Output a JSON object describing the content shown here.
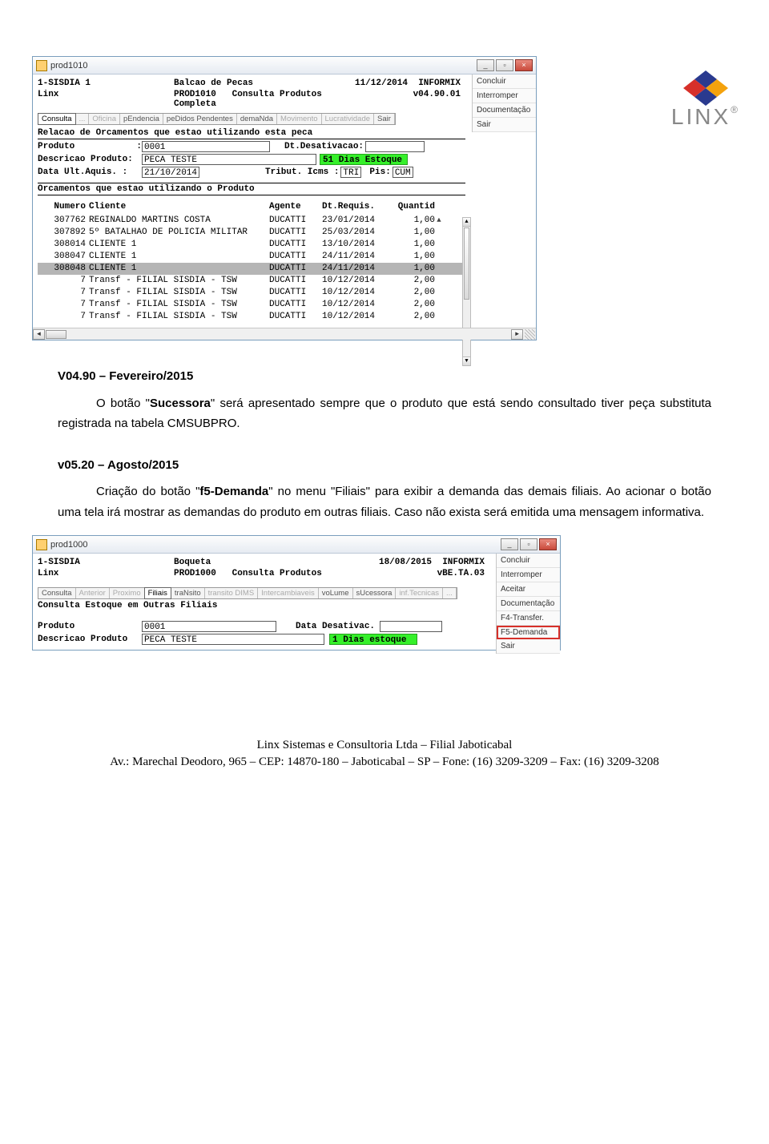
{
  "logo": {
    "text": "LINX",
    "reg": "®"
  },
  "win1": {
    "title": "prod1010",
    "header": {
      "l1a": "1-SISDIA 1",
      "l1b": "Balcao de Pecas",
      "l1c_date": "11/12/2014",
      "l1c_db": "INFORMIX",
      "l2a": "Linx",
      "l2b_prog": "PROD1010",
      "l2b_desc": "Consulta Produtos Completa",
      "l2c": "v04.90.01"
    },
    "tabs": [
      "Consulta",
      "...",
      "Oficina",
      "pEndencia",
      "peDidos Pendentes",
      "demaNda",
      "Movimento",
      "Lucratividade",
      "Sair"
    ],
    "panel_title": "Relacao de Orcamentos que estao utilizando esta peca",
    "fields": {
      "produto_lbl": "Produto",
      "produto_sep": ":",
      "produto_val": "0001",
      "dtdes_lbl": "Dt.Desativacao:",
      "desc_lbl": "Descricao Produto:",
      "desc_val": "PECA TESTE",
      "estoque": "51 Dias Estoque",
      "data_lbl": "Data  Ult.Aquis.  :",
      "data_val": "21/10/2014",
      "trib_lbl": "Tribut. Icms  :",
      "trib_val": "TRI",
      "pis_lbl": "Pis:",
      "pis_val": "CUM"
    },
    "panel_title2": "Orcamentos que estao utilizando o Produto",
    "grid_head": {
      "num": "Numero",
      "cli": "Cliente",
      "ag": "Agente",
      "dt": "Dt.Requis.",
      "qt": "Quantid"
    },
    "rows": [
      {
        "num": "307762",
        "cli": "REGINALDO MARTINS COSTA",
        "ag": "DUCATTI",
        "dt": "23/01/2014",
        "qt": "1,00"
      },
      {
        "num": "307892",
        "cli": "5º BATALHAO DE POLICIA MILITAR",
        "ag": "DUCATTI",
        "dt": "25/03/2014",
        "qt": "1,00"
      },
      {
        "num": "308014",
        "cli": "CLIENTE 1",
        "ag": "DUCATTI",
        "dt": "13/10/2014",
        "qt": "1,00"
      },
      {
        "num": "308047",
        "cli": "CLIENTE 1",
        "ag": "DUCATTI",
        "dt": "24/11/2014",
        "qt": "1,00"
      },
      {
        "num": "308048",
        "cli": "CLIENTE 1",
        "ag": "DUCATTI",
        "dt": "24/11/2014",
        "qt": "1,00",
        "sel": true
      },
      {
        "num": "7",
        "cli": "Transf - FILIAL SISDIA - TSW",
        "ag": "DUCATTI",
        "dt": "10/12/2014",
        "qt": "2,00"
      },
      {
        "num": "7",
        "cli": "Transf - FILIAL SISDIA - TSW",
        "ag": "DUCATTI",
        "dt": "10/12/2014",
        "qt": "2,00"
      },
      {
        "num": "7",
        "cli": "Transf - FILIAL SISDIA - TSW",
        "ag": "DUCATTI",
        "dt": "10/12/2014",
        "qt": "2,00"
      },
      {
        "num": "7",
        "cli": "Transf - FILIAL SISDIA - TSW",
        "ag": "DUCATTI",
        "dt": "10/12/2014",
        "qt": "2,00"
      }
    ],
    "side": [
      "Concluir",
      "Interromper",
      "Documentação",
      "Sair"
    ]
  },
  "doc": {
    "h1": "V04.90 – Fevereiro/2015",
    "p1a": "O botão \"",
    "p1b": "Sucessora",
    "p1c": "\" será apresentado sempre que o produto que está sendo consultado tiver peça substituta registrada na tabela CMSUBPRO.",
    "h2": "v05.20 – Agosto/2015",
    "p2a": "Criação do botão \"",
    "p2b": "f5-Demanda",
    "p2c": "\" no menu \"Filiais\" para exibir a demanda das demais filiais. Ao acionar o botão uma tela irá mostrar as demandas do produto em outras filiais. Caso não exista será emitida uma mensagem informativa."
  },
  "win2": {
    "title": "prod1000",
    "header": {
      "l1a": "1-SISDIA",
      "l1b": "Boqueta",
      "l1c_date": "18/08/2015",
      "l1c_db": "INFORMIX",
      "l2a": "Linx",
      "l2b_prog": "PROD1000",
      "l2b_desc": "Consulta Produtos",
      "l2c": "vBE.TA.03"
    },
    "tabs": [
      "Consulta",
      "Anterior",
      "Proximo",
      "Filiais",
      "traNsito",
      "transito DIMS",
      "Intercambiaveis",
      "voLume",
      "sUcessora",
      "inf.Tecnicas",
      "..."
    ],
    "panel_title": "Consulta Estoque em Outras Filiais",
    "fields": {
      "produto_lbl": "Produto",
      "produto_val": "0001",
      "dtdes_lbl": "Data Desativac.",
      "desc_lbl": "Descricao Produto",
      "desc_val": "PECA TESTE",
      "estoque": "1 Dias estoque"
    },
    "side": [
      "Concluir",
      "Interromper",
      "Aceitar",
      "Documentação",
      "F4-Transfer.",
      "F5-Demanda",
      "Sair"
    ],
    "side_highlight": "F5-Demanda"
  },
  "footer": {
    "l1": "Linx Sistemas e Consultoria Ltda – Filial Jaboticabal",
    "l2": "Av.: Marechal Deodoro, 965 – CEP: 14870-180 – Jaboticabal – SP – Fone: (16) 3209-3209 – Fax: (16) 3209-3208"
  }
}
